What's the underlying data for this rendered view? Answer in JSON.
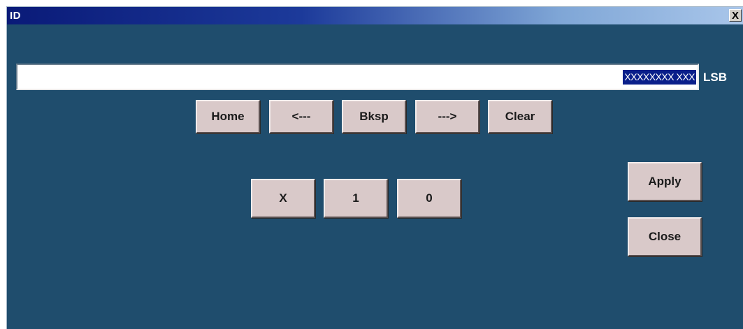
{
  "window": {
    "title": "ID",
    "close_label": "X"
  },
  "entry": {
    "value": "XXXXXXXX XXX",
    "suffix": "LSB"
  },
  "nav_buttons": {
    "home": "Home",
    "left": "<---",
    "bksp": "Bksp",
    "right": "--->",
    "clear": "Clear"
  },
  "value_buttons": {
    "x": "X",
    "one": "1",
    "zero": "0"
  },
  "actions": {
    "apply": "Apply",
    "close": "Close"
  },
  "colors": {
    "window_bg": "#1f4d6d",
    "button_bg": "#d9c9c9",
    "selection_bg": "#0a1f8a"
  }
}
